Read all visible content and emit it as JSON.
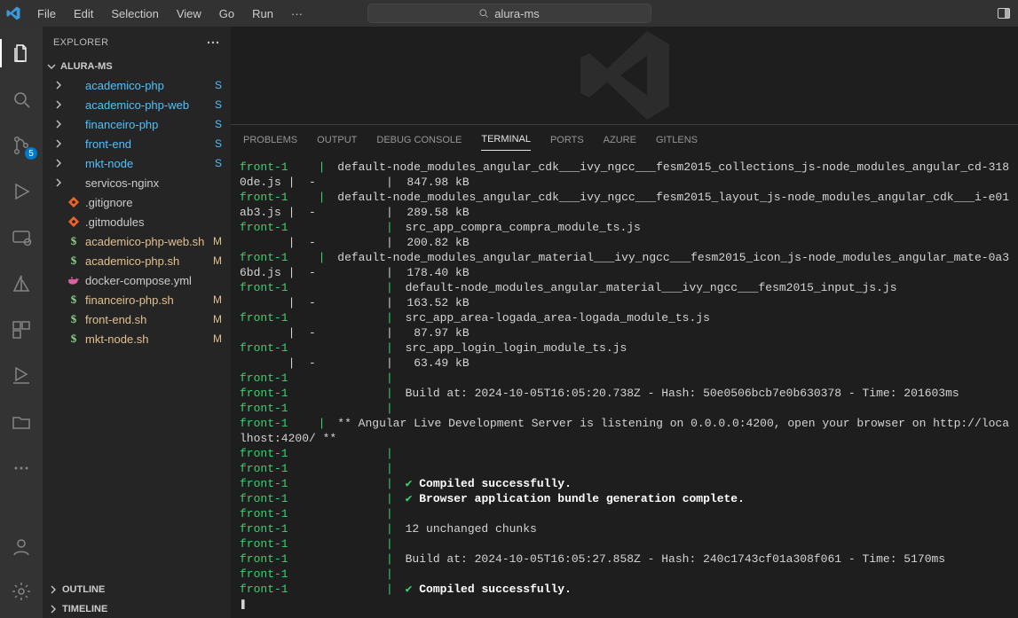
{
  "menu": {
    "file": "File",
    "edit": "Edit",
    "selection": "Selection",
    "view": "View",
    "go": "Go",
    "run": "Run",
    "more": "···"
  },
  "search": {
    "label": "alura-ms"
  },
  "explorer": {
    "title": "EXPLORER",
    "root": "ALURA-MS",
    "items": [
      {
        "name": "academico-php",
        "kind": "folder",
        "git": "S"
      },
      {
        "name": "academico-php-web",
        "kind": "folder",
        "git": "S"
      },
      {
        "name": "financeiro-php",
        "kind": "folder",
        "git": "S"
      },
      {
        "name": "front-end",
        "kind": "folder",
        "git": "S"
      },
      {
        "name": "mkt-node",
        "kind": "folder",
        "git": "S"
      },
      {
        "name": "servicos-nginx",
        "kind": "folder",
        "git": ""
      },
      {
        "name": ".gitignore",
        "kind": "gitignore",
        "git": ""
      },
      {
        "name": ".gitmodules",
        "kind": "gitmodules",
        "git": ""
      },
      {
        "name": "academico-php-web.sh",
        "kind": "sh",
        "git": "M"
      },
      {
        "name": "academico-php.sh",
        "kind": "sh",
        "git": "M"
      },
      {
        "name": "docker-compose.yml",
        "kind": "docker",
        "git": ""
      },
      {
        "name": "financeiro-php.sh",
        "kind": "sh",
        "git": "M"
      },
      {
        "name": "front-end.sh",
        "kind": "sh",
        "git": "M"
      },
      {
        "name": "mkt-node.sh",
        "kind": "sh",
        "git": "M"
      }
    ],
    "outline": "OUTLINE",
    "timeline": "TIMELINE"
  },
  "scmBadge": "5",
  "panel": {
    "tabs": [
      "PROBLEMS",
      "OUTPUT",
      "DEBUG CONSOLE",
      "TERMINAL",
      "PORTS",
      "AZURE",
      "GITLENS"
    ],
    "active": "TERMINAL"
  },
  "terminal": [
    {
      "pfx": "front-1",
      "cont": "",
      "text": "default-node_modules_angular_cdk___ivy_ngcc___fesm2015_collections_js-node_modules_angular_cd-318"
    },
    {
      "pfx": "0de.js |  -",
      "cont": "raw",
      "text": "|  847.98 kB"
    },
    {
      "pfx": "front-1",
      "cont": "",
      "text": "default-node_modules_angular_cdk___ivy_ngcc___fesm2015_layout_js-node_modules_angular_cdk___i-e01"
    },
    {
      "pfx": "ab3.js |  -",
      "cont": "raw",
      "text": "|  289.58 kB"
    },
    {
      "pfx": "front-1",
      "cont": "",
      "text": "src_app_compra_compra_module_ts.js"
    },
    {
      "pfx": "       |  -",
      "cont": "raw",
      "text": "|  200.82 kB"
    },
    {
      "pfx": "front-1",
      "cont": "",
      "text": "default-node_modules_angular_material___ivy_ngcc___fesm2015_icon_js-node_modules_angular_mate-0a3"
    },
    {
      "pfx": "6bd.js |  -",
      "cont": "raw",
      "text": "|  178.40 kB"
    },
    {
      "pfx": "front-1",
      "cont": "",
      "text": "default-node_modules_angular_material___ivy_ngcc___fesm2015_input_js.js"
    },
    {
      "pfx": "       |  -",
      "cont": "raw",
      "text": "|  163.52 kB"
    },
    {
      "pfx": "front-1",
      "cont": "",
      "text": "src_app_area-logada_area-logada_module_ts.js"
    },
    {
      "pfx": "       |  -",
      "cont": "raw",
      "text": "|   87.97 kB"
    },
    {
      "pfx": "front-1",
      "cont": "",
      "text": "src_app_login_login_module_ts.js"
    },
    {
      "pfx": "       |  -",
      "cont": "raw",
      "text": "|   63.49 kB"
    },
    {
      "pfx": "front-1",
      "cont": "",
      "text": ""
    },
    {
      "pfx": "front-1",
      "cont": "",
      "text": "Build at: 2024-10-05T16:05:20.738Z - Hash: 50e0506bcb7e0b630378 - Time: 201603ms"
    },
    {
      "pfx": "front-1",
      "cont": "",
      "text": ""
    },
    {
      "pfx": "front-1",
      "cont": "",
      "text": "** Angular Live Development Server is listening on 0.0.0.0:4200, open your browser on http://loca"
    },
    {
      "pfx": "lhost:4200/ **",
      "cont": "plain",
      "text": ""
    },
    {
      "pfx": "front-1",
      "cont": "",
      "text": ""
    },
    {
      "pfx": "front-1",
      "cont": "",
      "text": ""
    },
    {
      "pfx": "front-1",
      "cont": "check",
      "text": "Compiled successfully."
    },
    {
      "pfx": "front-1",
      "cont": "check",
      "text": "Browser application bundle generation complete."
    },
    {
      "pfx": "front-1",
      "cont": "",
      "text": ""
    },
    {
      "pfx": "front-1",
      "cont": "",
      "text": "12 unchanged chunks"
    },
    {
      "pfx": "front-1",
      "cont": "",
      "text": ""
    },
    {
      "pfx": "front-1",
      "cont": "",
      "text": "Build at: 2024-10-05T16:05:27.858Z - Hash: 240c1743cf01a308f061 - Time: 5170ms"
    },
    {
      "pfx": "front-1",
      "cont": "",
      "text": ""
    },
    {
      "pfx": "front-1",
      "cont": "check",
      "text": "Compiled successfully."
    }
  ],
  "cursor": "❚"
}
